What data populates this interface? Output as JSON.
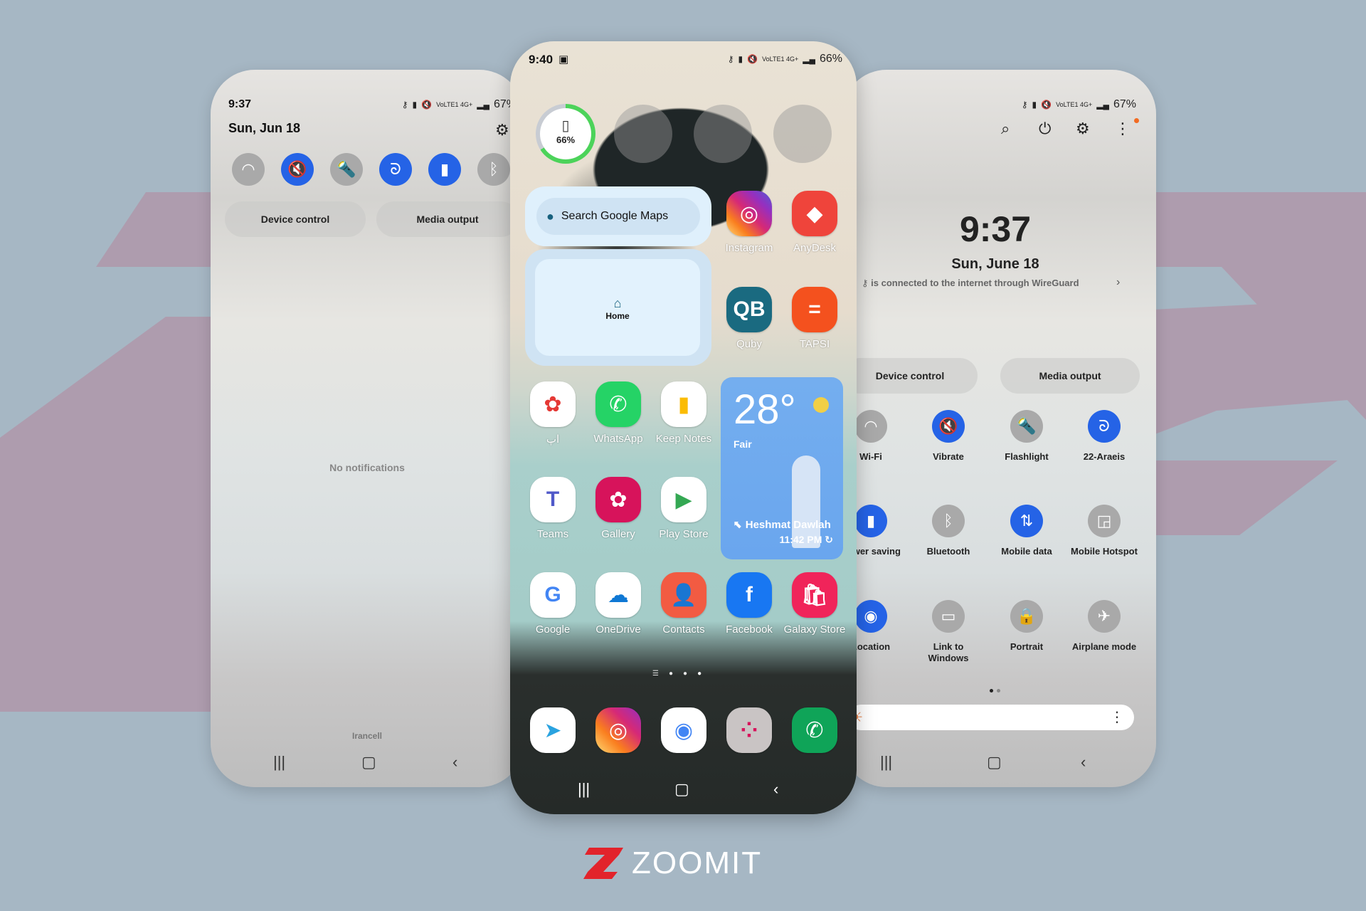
{
  "colors": {
    "background": "#a6b7c4",
    "z_shape": "#ae9cae",
    "toggle_on": "#2563e6",
    "toggle_off": "#a9a9a9",
    "brand_red": "#e2232b"
  },
  "left_phone": {
    "status": {
      "time": "9:37",
      "battery": "67%",
      "network": "VoLTE1 4G+"
    },
    "date": "Sun, Jun 18",
    "settings_icon": "gear-icon",
    "quick_toggles": [
      {
        "name": "Wi-Fi",
        "icon": "wifi-icon",
        "glyph": "◠",
        "on": false
      },
      {
        "name": "Vibrate",
        "icon": "vibrate-icon",
        "glyph": "🔇",
        "on": true
      },
      {
        "name": "Flashlight",
        "icon": "flashlight-icon",
        "glyph": "🔦",
        "on": false
      },
      {
        "name": "22-Araeis",
        "icon": "wireguard-icon",
        "glyph": "ᘐ",
        "on": true
      },
      {
        "name": "Power saving",
        "icon": "battery-saver-icon",
        "glyph": "▮",
        "on": true
      },
      {
        "name": "Bluetooth",
        "icon": "bluetooth-icon",
        "glyph": "ᛒ",
        "on": false
      }
    ],
    "device_control": "Device control",
    "media_output": "Media output",
    "empty_state": "No notifications",
    "carrier": "Irancell"
  },
  "center_phone": {
    "status": {
      "time": "9:40",
      "battery": "66%",
      "network": "VoLTE1 4G+"
    },
    "battery_widget": {
      "label": "66%",
      "level": 0.66
    },
    "maps_widget": {
      "search_label": "Search Google Maps",
      "home_label": "Home"
    },
    "weather": {
      "temp": "28°",
      "condition": "Fair",
      "location": "Heshmat Dawlah",
      "updated": "11:42 PM"
    },
    "apps_top": [
      {
        "label": "Instagram",
        "bg": "linear-gradient(45deg,#feda75,#fa7e1e,#d62976,#962fbf,#4f5bd5)",
        "glyph": "◎"
      },
      {
        "label": "AnyDesk",
        "bg": "#ef443b",
        "glyph": "◆"
      },
      {
        "label": "Quby",
        "bg": "#1a6a80",
        "glyph": "QB"
      },
      {
        "label": "TAPSI",
        "bg": "#f4511e",
        "glyph": "="
      }
    ],
    "apps_grid": [
      {
        "label": "اپ",
        "bg": "#ffffff",
        "fg": "#e53935",
        "glyph": "✿"
      },
      {
        "label": "WhatsApp",
        "bg": "#25d366",
        "fg": "#ffffff",
        "glyph": "✆"
      },
      {
        "label": "Keep Notes",
        "bg": "#ffffff",
        "fg": "#fbbc04",
        "glyph": "▮"
      },
      {
        "label": "Teams",
        "bg": "#ffffff",
        "fg": "#5059c9",
        "glyph": "T"
      },
      {
        "label": "Gallery",
        "bg": "#d7135b",
        "fg": "#ffffff",
        "glyph": "✿"
      },
      {
        "label": "Play Store",
        "bg": "#ffffff",
        "fg": "#34a853",
        "glyph": "▶"
      },
      {
        "label": "Google",
        "bg": "#ffffff",
        "fg": "#4285f4",
        "glyph": "G"
      },
      {
        "label": "OneDrive",
        "bg": "#ffffff",
        "fg": "#0f78d4",
        "glyph": "☁"
      },
      {
        "label": "Contacts",
        "bg": "#f25b42",
        "fg": "#ffffff",
        "glyph": "👤"
      },
      {
        "label": "Facebook",
        "bg": "#1877f2",
        "fg": "#ffffff",
        "glyph": "f"
      },
      {
        "label": "Galaxy Store",
        "bg": "#f0245a",
        "fg": "#ffffff",
        "glyph": "🛍"
      }
    ],
    "page_indicator": {
      "pages": 4,
      "active": 3
    },
    "dock": [
      {
        "name": "Telegram",
        "bg": "#ffffff",
        "fg": "#2aa3e0",
        "glyph": "➤"
      },
      {
        "name": "Instagram",
        "bg": "linear-gradient(45deg,#feda75,#fa7e1e,#d62976,#962fbf)",
        "fg": "#ffffff",
        "glyph": "◎"
      },
      {
        "name": "Chrome",
        "bg": "#ffffff",
        "fg": "#4285f4",
        "glyph": "◉"
      },
      {
        "name": "Folder",
        "bg": "#c9c4c4",
        "fg": "#d7135b",
        "glyph": "⁘"
      },
      {
        "name": "Phone",
        "bg": "#0fa458",
        "fg": "#ffffff",
        "glyph": "✆"
      }
    ]
  },
  "right_phone": {
    "status": {
      "battery": "67%",
      "network": "VoLTE1 4G+"
    },
    "top_icons": [
      "search-icon",
      "power-icon",
      "gear-icon",
      "more-icon"
    ],
    "clock": "9:37",
    "date": "Sun, June 18",
    "vpn_notice": "is connected to the internet through WireGuard",
    "device_control": "Device control",
    "media_output": "Media output",
    "tiles": [
      {
        "label": "Wi-Fi",
        "icon": "wifi-icon",
        "glyph": "◠",
        "on": false
      },
      {
        "label": "Vibrate",
        "icon": "vibrate-icon",
        "glyph": "🔇",
        "on": true
      },
      {
        "label": "Flashlight",
        "icon": "flashlight-icon",
        "glyph": "🔦",
        "on": false
      },
      {
        "label": "22-Araeis",
        "icon": "wireguard-icon",
        "glyph": "ᘐ",
        "on": true
      },
      {
        "label": "Power saving",
        "icon": "battery-saver-icon",
        "glyph": "▮",
        "on": true
      },
      {
        "label": "Bluetooth",
        "icon": "bluetooth-icon",
        "glyph": "ᛒ",
        "on": false
      },
      {
        "label": "Mobile data",
        "icon": "mobile-data-icon",
        "glyph": "⇅",
        "on": true
      },
      {
        "label": "Mobile Hotspot",
        "icon": "hotspot-icon",
        "glyph": "◲",
        "on": false
      },
      {
        "label": "Location",
        "icon": "location-icon",
        "glyph": "◉",
        "on": true
      },
      {
        "label": "Link to Windows",
        "icon": "link-windows-icon",
        "glyph": "▭",
        "on": false
      },
      {
        "label": "Portrait",
        "icon": "portrait-lock-icon",
        "glyph": "🔒",
        "on": false
      },
      {
        "label": "Airplane mode",
        "icon": "airplane-icon",
        "glyph": "✈",
        "on": false
      }
    ],
    "page_dots": {
      "pages": 2,
      "active": 0
    },
    "brightness": {
      "level": 0.05
    }
  },
  "brand": {
    "logo": "ZOOMIT"
  }
}
